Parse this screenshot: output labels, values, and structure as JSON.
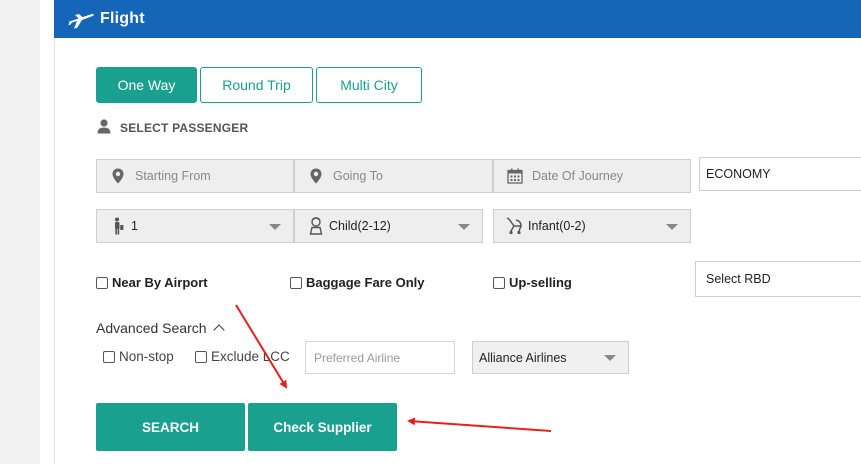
{
  "header": {
    "title": "Flight",
    "icon": "airplane-icon",
    "color": "#1565b8"
  },
  "trip_tabs": [
    {
      "label": "One Way",
      "active": true
    },
    {
      "label": "Round Trip",
      "active": false
    },
    {
      "label": "Multi City",
      "active": false
    }
  ],
  "passenger_section": {
    "label": "SELECT PASSENGER",
    "icon": "user-icon"
  },
  "search_fields": {
    "from_placeholder": "Starting From",
    "to_placeholder": "Going To",
    "date_placeholder": "Date Of Journey",
    "cabin_value": "ECONOMY"
  },
  "passengers": {
    "adult_value": "1",
    "child_value": "Child(2-12)",
    "infant_value": "Infant(0-2)"
  },
  "options": {
    "near_by_airport": "Near By Airport",
    "baggage_fare_only": "Baggage Fare Only",
    "up_selling": "Up-selling",
    "rbd_value": "Select RBD"
  },
  "advanced": {
    "label": "Advanced Search",
    "non_stop": "Non-stop",
    "exclude_lcc": "Exclude LCC",
    "airline_placeholder": "Preferred Airline",
    "alliance_value": "Alliance Airlines"
  },
  "actions": {
    "search_label": "SEARCH",
    "check_supplier_label": "Check Supplier"
  },
  "colors": {
    "accent": "#1aa08f",
    "annotation": "#e8201c"
  }
}
